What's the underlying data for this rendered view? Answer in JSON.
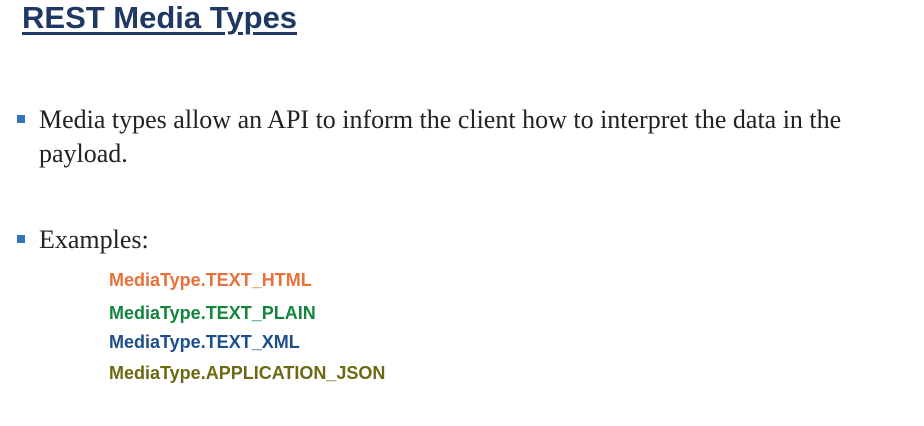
{
  "slide": {
    "title": "REST Media Types",
    "bullets": [
      {
        "text": "Media types allow an API to inform the client how to interpret the data in the payload."
      },
      {
        "text": "Examples:"
      }
    ],
    "examples": [
      {
        "text": "MediaType.TEXT_HTML",
        "color": "#e8703a"
      },
      {
        "text": "MediaType.TEXT_PLAIN",
        "color": "#14853d"
      },
      {
        "text": "MediaType.TEXT_XML",
        "color": "#1c4f8c"
      },
      {
        "text": "MediaType.APPLICATION_JSON",
        "color": "#6b6a12"
      }
    ],
    "colors": {
      "title": "#1f3864",
      "bullet_marker": "#2e75b6",
      "body_text": "#222222"
    }
  }
}
